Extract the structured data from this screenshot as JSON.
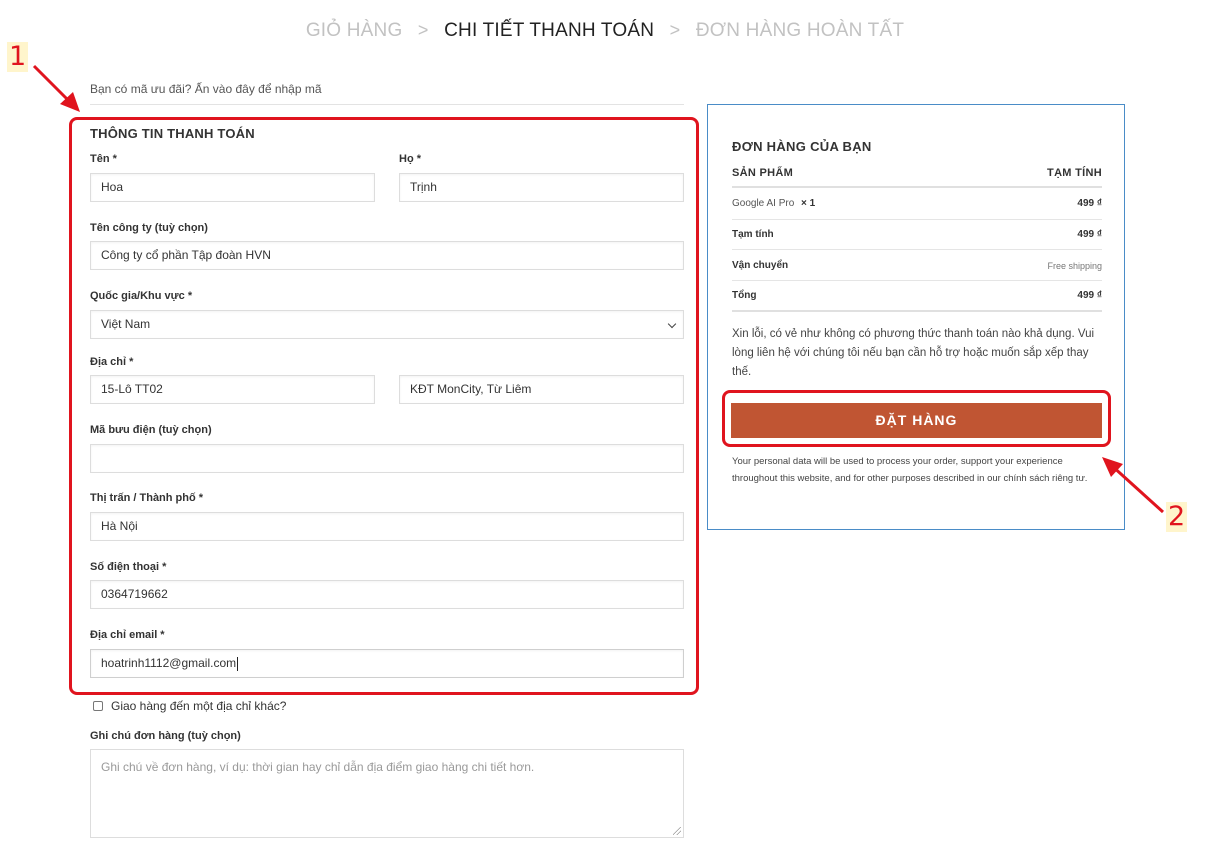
{
  "steps": {
    "cart": "GIỎ HÀNG",
    "separator": ">",
    "checkout": "CHI TIẾT THANH TOÁN",
    "complete": "ĐƠN HÀNG HOÀN TẤT"
  },
  "coupon": {
    "text": "Bạn có mã ưu đãi?",
    "link": "Ấn vào đây để nhập mã"
  },
  "billing": {
    "title": "THÔNG TIN THANH TOÁN",
    "first_name_label": "Tên *",
    "first_name_value": "Hoa",
    "last_name_label": "Họ *",
    "last_name_value": "Trịnh",
    "company_label": "Tên công ty (tuỳ chọn)",
    "company_value": "Công ty cổ phần Tập đoàn HVN",
    "country_label": "Quốc gia/Khu vực *",
    "country_value": "Việt Nam",
    "address_label": "Địa chỉ *",
    "address_1_value": "15-Lô TT02",
    "address_2_value": "KĐT MonCity, Từ Liêm",
    "postcode_label": "Mã bưu điện (tuỳ chọn)",
    "postcode_value": "",
    "city_label": "Thị trấn / Thành phố *",
    "city_value": "Hà Nội",
    "phone_label": "Số điện thoại *",
    "phone_value": "0364719662",
    "email_label": "Địa chỉ email *",
    "email_value": "hoatrinh1112@gmail.com"
  },
  "shipping": {
    "different_address_label": "Giao hàng đến một địa chỉ khác?"
  },
  "notes": {
    "label": "Ghi chú đơn hàng (tuỳ chọn)",
    "placeholder": "Ghi chú về đơn hàng, ví dụ: thời gian hay chỉ dẫn địa điểm giao hàng chi tiết hơn."
  },
  "order": {
    "title": "ĐƠN HÀNG CỦA BẠN",
    "col_product": "SẢN PHẨM",
    "col_subtotal": "TẠM TÍNH",
    "item_name": "Google AI Pro",
    "item_qty": "× 1",
    "item_price": "499 ₫",
    "subtotal_label": "Tạm tính",
    "subtotal_value": "499 ₫",
    "shipping_label": "Vận chuyển",
    "shipping_value": "Free shipping",
    "total_label": "Tổng",
    "total_value": "499 ₫",
    "notice": "Xin lỗi, có vẻ như không có phương thức thanh toán nào khả dụng. Vui lòng liên hệ với chúng tôi nếu bạn cần hỗ trợ hoặc muốn sắp xếp thay thế.",
    "place_order": "ĐẶT HÀNG",
    "privacy_text": "Your personal data will be used to process your order, support your experience throughout this website, and for other purposes described in our",
    "privacy_link": "chính sách riêng tư."
  },
  "annotations": {
    "marker_1": "1",
    "marker_2": "2",
    "color": "#e0141e"
  },
  "colors": {
    "button": "#c05533",
    "order_border": "#4a8cc7"
  }
}
